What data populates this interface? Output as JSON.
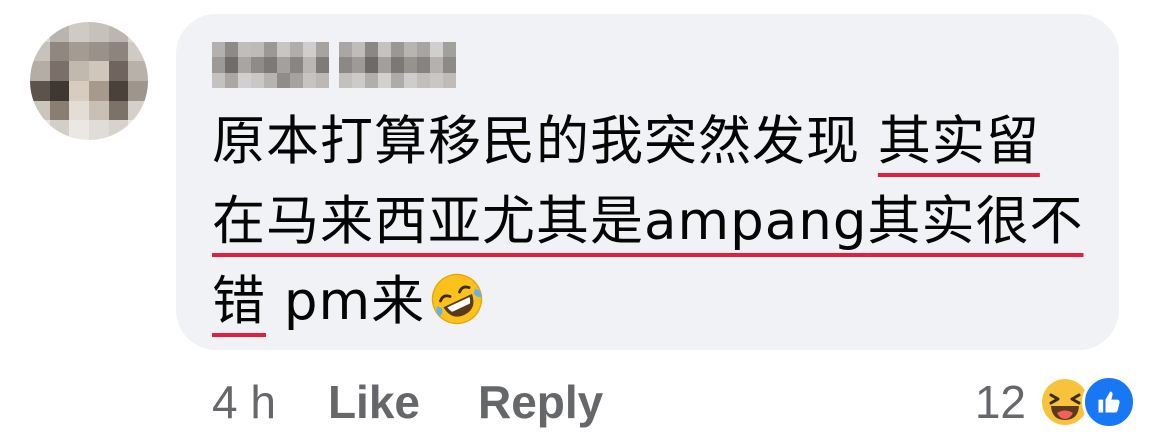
{
  "comment": {
    "author_name": "",
    "text_before": "原本打算移民的我突然发现 ",
    "text_underlined": "其实留在马来西亚尤其是",
    "text_latin": "ampang",
    "text_underlined_2": "其实很不错",
    "text_after": " pm来",
    "emoji": "rolling-on-floor-laughing",
    "underline_color": "#e41e3f",
    "bubble_color": "#f0f2f5"
  },
  "footer": {
    "timestamp": "4 h",
    "like_label": "Like",
    "reply_label": "Reply"
  },
  "reactions": {
    "count": "12",
    "types": [
      "haha",
      "like"
    ]
  },
  "colors": {
    "meta_text": "#65676b",
    "like_blue": "#1877f2",
    "haha_yellow": "#f7c33a"
  }
}
